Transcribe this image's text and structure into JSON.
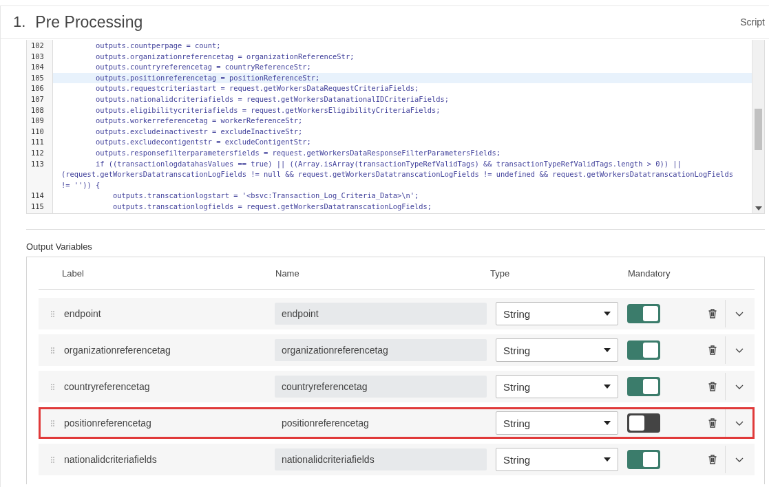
{
  "section": {
    "number": "1.",
    "title": "Pre Processing",
    "mode_link": "Script"
  },
  "editor": {
    "lines": [
      {
        "number": "102",
        "selected": false,
        "text": "        outputs.countperpage = count;"
      },
      {
        "number": "103",
        "selected": false,
        "text": "        outputs.organizationreferencetag = organizationReferenceStr;"
      },
      {
        "number": "104",
        "selected": false,
        "text": "        outputs.countryreferencetag = countryReferenceStr;"
      },
      {
        "number": "105",
        "selected": true,
        "text": "        outputs.positionreferencetag = positionReferenceStr;"
      },
      {
        "number": "106",
        "selected": false,
        "text": "        outputs.requestcriteriastart = request.getWorkersDataRequestCriteriaFields;"
      },
      {
        "number": "107",
        "selected": false,
        "text": "        outputs.nationalidcriteriafields = request.getWorkersDatanationalIDCriteriaFields;"
      },
      {
        "number": "108",
        "selected": false,
        "text": "        outputs.eligibilitycriteriafields = request.getWorkersEligibilityCriteriaFields;"
      },
      {
        "number": "109",
        "selected": false,
        "text": "        outputs.workerreferencetag = workerReferenceStr;"
      },
      {
        "number": "110",
        "selected": false,
        "text": "        outputs.excludeinactivestr = excludeInactiveStr;"
      },
      {
        "number": "111",
        "selected": false,
        "text": "        outputs.excludecontigentstr = excludeContigentStr;"
      },
      {
        "number": "112",
        "selected": false,
        "text": "        outputs.responsefilterparametersfields = request.getWorkersDataResponseFilterParametersFields;"
      },
      {
        "number": "113",
        "selected": false,
        "text": "        if ((transactionlogdatahasValues == true) || ((Array.isArray(transactionTypeRefValidTags) && transactionTypeRefValidTags.length > 0)) ||",
        "continuation": [
          "(request.getWorkersDatatranscationLogFields != null && request.getWorkersDatatranscationLogFields != undefined && request.getWorkersDatatranscationLogFields",
          "!= '')) {"
        ]
      },
      {
        "number": "114",
        "selected": false,
        "text": "            outputs.transcationlogstart = '<bsvc:Transaction_Log_Criteria_Data>\\n';"
      },
      {
        "number": "115",
        "selected": false,
        "text": "            outputs.transcationlogfields = request.getWorkersDatatranscationLogFields;"
      }
    ]
  },
  "output_variables": {
    "heading": "Output Variables",
    "columns": [
      "Label",
      "Name",
      "Type",
      "Mandatory"
    ],
    "rows": [
      {
        "label": "endpoint",
        "name": "endpoint",
        "name_locked": true,
        "type": "String",
        "mandatory": true,
        "highlighted": false
      },
      {
        "label": "organizationreferencetag",
        "name": "organizationreferencetag",
        "name_locked": true,
        "type": "String",
        "mandatory": true,
        "highlighted": false
      },
      {
        "label": "countryreferencetag",
        "name": "countryreferencetag",
        "name_locked": true,
        "type": "String",
        "mandatory": true,
        "highlighted": false
      },
      {
        "label": "positionreferencetag",
        "name": "positionreferencetag",
        "name_locked": false,
        "type": "String",
        "mandatory": false,
        "highlighted": true
      },
      {
        "label": "nationalidcriteriafields",
        "name": "nationalidcriteriafields",
        "name_locked": true,
        "type": "String",
        "mandatory": true,
        "highlighted": false
      }
    ]
  }
}
